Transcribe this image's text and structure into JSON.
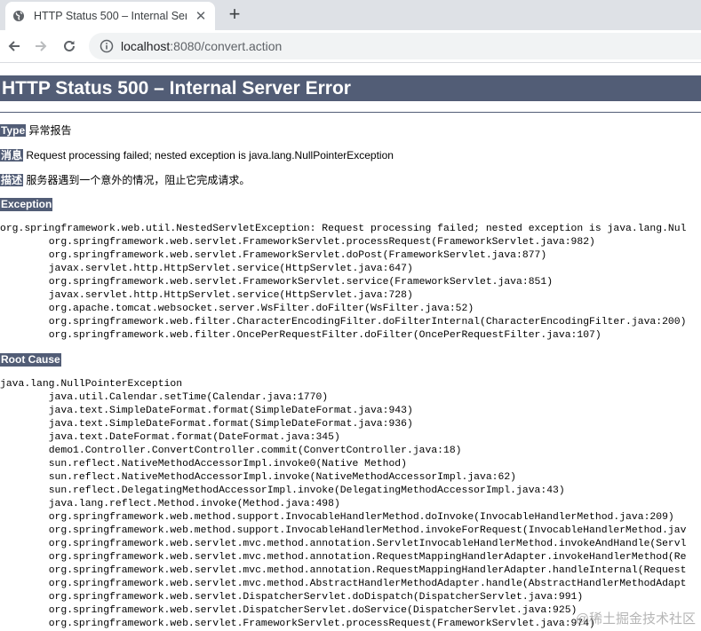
{
  "browser": {
    "tab_title": "HTTP Status 500 – Internal Ser",
    "new_tab_symbol": "+",
    "url_host": "localhost",
    "url_rest": ":8080/convert.action"
  },
  "page": {
    "heading": "HTTP Status 500 – Internal Server Error",
    "type_label": "Type",
    "type_value": "异常报告",
    "message_label": "消息",
    "message_value": "Request processing failed; nested exception is java.lang.NullPointerException",
    "description_label": "描述",
    "description_value": "服务器遇到一个意外的情况，阻止它完成请求。",
    "exception_label": "Exception",
    "exception_trace": "org.springframework.web.util.NestedServletException: Request processing failed; nested exception is java.lang.Nul\n\torg.springframework.web.servlet.FrameworkServlet.processRequest(FrameworkServlet.java:982)\n\torg.springframework.web.servlet.FrameworkServlet.doPost(FrameworkServlet.java:877)\n\tjavax.servlet.http.HttpServlet.service(HttpServlet.java:647)\n\torg.springframework.web.servlet.FrameworkServlet.service(FrameworkServlet.java:851)\n\tjavax.servlet.http.HttpServlet.service(HttpServlet.java:728)\n\torg.apache.tomcat.websocket.server.WsFilter.doFilter(WsFilter.java:52)\n\torg.springframework.web.filter.CharacterEncodingFilter.doFilterInternal(CharacterEncodingFilter.java:200)\n\torg.springframework.web.filter.OncePerRequestFilter.doFilter(OncePerRequestFilter.java:107)",
    "root_cause_label": "Root Cause",
    "root_cause_trace": "java.lang.NullPointerException\n\tjava.util.Calendar.setTime(Calendar.java:1770)\n\tjava.text.SimpleDateFormat.format(SimpleDateFormat.java:943)\n\tjava.text.SimpleDateFormat.format(SimpleDateFormat.java:936)\n\tjava.text.DateFormat.format(DateFormat.java:345)\n\tdemo1.Controller.ConvertController.commit(ConvertController.java:18)\n\tsun.reflect.NativeMethodAccessorImpl.invoke0(Native Method)\n\tsun.reflect.NativeMethodAccessorImpl.invoke(NativeMethodAccessorImpl.java:62)\n\tsun.reflect.DelegatingMethodAccessorImpl.invoke(DelegatingMethodAccessorImpl.java:43)\n\tjava.lang.reflect.Method.invoke(Method.java:498)\n\torg.springframework.web.method.support.InvocableHandlerMethod.doInvoke(InvocableHandlerMethod.java:209)\n\torg.springframework.web.method.support.InvocableHandlerMethod.invokeForRequest(InvocableHandlerMethod.jav\n\torg.springframework.web.servlet.mvc.method.annotation.ServletInvocableHandlerMethod.invokeAndHandle(Servl\n\torg.springframework.web.servlet.mvc.method.annotation.RequestMappingHandlerAdapter.invokeHandlerMethod(Re\n\torg.springframework.web.servlet.mvc.method.annotation.RequestMappingHandlerAdapter.handleInternal(Request\n\torg.springframework.web.servlet.mvc.method.AbstractHandlerMethodAdapter.handle(AbstractHandlerMethodAdapt\n\torg.springframework.web.servlet.DispatcherServlet.doDispatch(DispatcherServlet.java:991)\n\torg.springframework.web.servlet.DispatcherServlet.doService(DispatcherServlet.java:925)\n\torg.springframework.web.servlet.FrameworkServlet.processRequest(FrameworkServlet.java:974)",
    "watermark": "@稀土掘金技术社区"
  }
}
